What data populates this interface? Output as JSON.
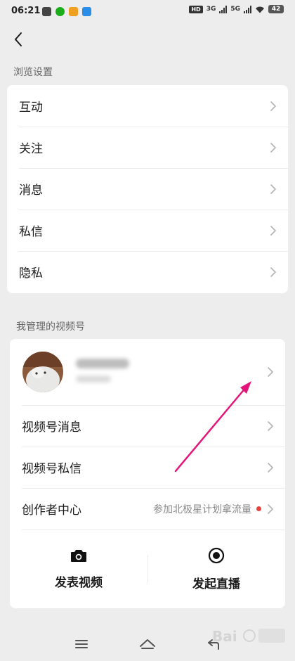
{
  "status_bar": {
    "time": "06:21",
    "hd": "HD",
    "net1": "3G",
    "net2": "5G",
    "battery": "42"
  },
  "browse_settings": {
    "title": "浏览设置",
    "items": [
      {
        "label": "互动"
      },
      {
        "label": "关注"
      },
      {
        "label": "消息"
      },
      {
        "label": "私信"
      },
      {
        "label": "隐私"
      }
    ]
  },
  "channels": {
    "title": "我管理的视频号",
    "items": [
      {
        "label": "视频号消息"
      },
      {
        "label": "视频号私信"
      }
    ],
    "creator": {
      "label": "创作者中心",
      "extra": "参加北极星计划拿流量"
    },
    "actions": {
      "post_video": "发表视频",
      "go_live": "发起直播"
    }
  },
  "colors": {
    "accent_red": "#e64340",
    "annotation_arrow": "#e4157a"
  },
  "icons": {
    "back": "back-arrow-icon",
    "chevron": "chevron-right-icon",
    "camera": "camera-icon",
    "live": "live-record-icon",
    "nav_menu": "menu-icon",
    "nav_home": "home-icon",
    "nav_back": "back-icon"
  }
}
